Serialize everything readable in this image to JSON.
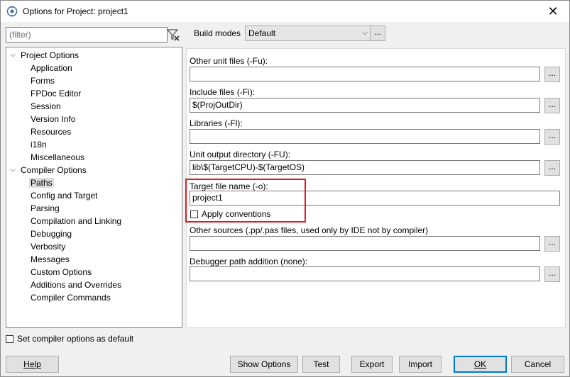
{
  "window": {
    "title": "Options for Project: project1"
  },
  "filter": {
    "placeholder": "(filter)"
  },
  "tree": {
    "items": [
      {
        "label": "Project Options",
        "level": 0,
        "expanded": true
      },
      {
        "label": "Application",
        "level": 1
      },
      {
        "label": "Forms",
        "level": 1
      },
      {
        "label": "FPDoc Editor",
        "level": 1
      },
      {
        "label": "Session",
        "level": 1
      },
      {
        "label": "Version Info",
        "level": 1
      },
      {
        "label": "Resources",
        "level": 1
      },
      {
        "label": "i18n",
        "level": 1
      },
      {
        "label": "Miscellaneous",
        "level": 1
      },
      {
        "label": "Compiler Options",
        "level": 0,
        "expanded": true
      },
      {
        "label": "Paths",
        "level": 1,
        "selected": true
      },
      {
        "label": "Config and Target",
        "level": 1
      },
      {
        "label": "Parsing",
        "level": 1
      },
      {
        "label": "Compilation and Linking",
        "level": 1
      },
      {
        "label": "Debugging",
        "level": 1
      },
      {
        "label": "Verbosity",
        "level": 1
      },
      {
        "label": "Messages",
        "level": 1
      },
      {
        "label": "Custom Options",
        "level": 1
      },
      {
        "label": "Additions and Overrides",
        "level": 1
      },
      {
        "label": "Compiler Commands",
        "level": 1
      }
    ]
  },
  "set_default": {
    "label": "Set compiler options as default",
    "checked": false
  },
  "build_modes": {
    "label": "Build modes",
    "value": "Default",
    "more": "..."
  },
  "fields": {
    "other_unit_files": {
      "label": "Other unit files (-Fu):",
      "value": ""
    },
    "include_files": {
      "label": "Include files (-Fi):",
      "value": "$(ProjOutDir)"
    },
    "libraries": {
      "label": "Libraries (-Fl):",
      "value": ""
    },
    "unit_output_dir": {
      "label": "Unit output directory (-FU):",
      "value": "lib\\$(TargetCPU)-$(TargetOS)"
    },
    "target_file_name": {
      "label": "Target file name (-o):",
      "value": "project1"
    },
    "apply_conventions": {
      "label": "Apply conventions",
      "checked": false
    },
    "other_sources": {
      "label": "Other sources (.pp/.pas files, used only by IDE not by compiler)",
      "value": ""
    },
    "debugger_path": {
      "label": "Debugger path addition (none):",
      "value": ""
    }
  },
  "browse": "...",
  "footer": {
    "help": "Help",
    "show_options": "Show Options",
    "test": "Test",
    "export": "Export",
    "import": "Import",
    "ok": "OK",
    "cancel": "Cancel"
  },
  "colors": {
    "highlight": "#e01b24",
    "default_button": "#0078d7"
  }
}
